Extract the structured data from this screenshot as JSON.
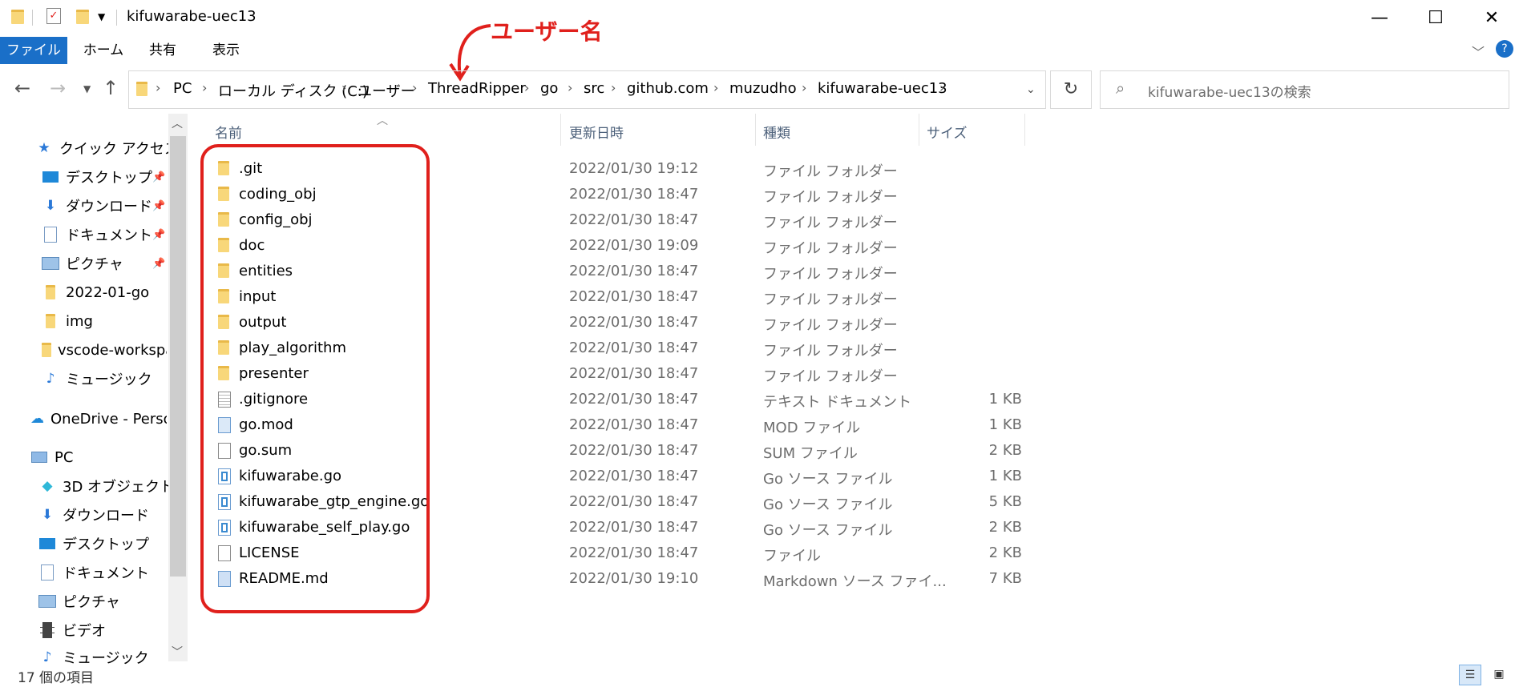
{
  "window": {
    "title": "kifuwarabe-uec13",
    "minimize": "—",
    "maximize": "☐",
    "close": "✕"
  },
  "ribbon": {
    "tabs": [
      "ファイル",
      "ホーム",
      "共有",
      "表示"
    ]
  },
  "address": {
    "breadcrumbs": [
      "PC",
      "ローカル ディスク (C:)",
      "ユーザー",
      "ThreadRipper",
      "go",
      "src",
      "github.com",
      "muzudho",
      "kifuwarabe-uec13"
    ]
  },
  "search": {
    "placeholder": "kifuwarabe-uec13の検索"
  },
  "annotation": {
    "text": "ユーザー名",
    "color": "#e0201c"
  },
  "sidebar": {
    "items": [
      {
        "label": "クイック アクセス",
        "icon": "star-icon"
      },
      {
        "label": "デスクトップ",
        "icon": "desktop-icon",
        "pinned": true
      },
      {
        "label": "ダウンロード",
        "icon": "download-icon",
        "pinned": true
      },
      {
        "label": "ドキュメント",
        "icon": "document-icon",
        "pinned": true
      },
      {
        "label": "ピクチャ",
        "icon": "picture-icon",
        "pinned": true
      },
      {
        "label": "2022-01-go",
        "icon": "folder-icon"
      },
      {
        "label": "img",
        "icon": "folder-icon"
      },
      {
        "label": "vscode-workspa",
        "icon": "folder-icon"
      },
      {
        "label": "ミュージック",
        "icon": "music-icon"
      },
      {
        "label": "OneDrive - Person",
        "icon": "cloud-icon"
      },
      {
        "label": "PC",
        "icon": "pc-icon"
      },
      {
        "label": "3D オブジェクト",
        "icon": "cube-icon"
      },
      {
        "label": "ダウンロード",
        "icon": "download-icon"
      },
      {
        "label": "デスクトップ",
        "icon": "desktop-icon"
      },
      {
        "label": "ドキュメント",
        "icon": "document-icon"
      },
      {
        "label": "ピクチャ",
        "icon": "picture-icon"
      },
      {
        "label": "ビデオ",
        "icon": "video-icon"
      },
      {
        "label": "ミュージック",
        "icon": "music-icon"
      }
    ]
  },
  "columns": {
    "name": "名前",
    "date": "更新日時",
    "type": "種類",
    "size": "サイズ"
  },
  "files": [
    {
      "name": ".git",
      "date": "2022/01/30 19:12",
      "type": "ファイル フォルダー",
      "size": "",
      "icon": "folder-icon"
    },
    {
      "name": "coding_obj",
      "date": "2022/01/30 18:47",
      "type": "ファイル フォルダー",
      "size": "",
      "icon": "folder-icon"
    },
    {
      "name": "config_obj",
      "date": "2022/01/30 18:47",
      "type": "ファイル フォルダー",
      "size": "",
      "icon": "folder-icon"
    },
    {
      "name": "doc",
      "date": "2022/01/30 19:09",
      "type": "ファイル フォルダー",
      "size": "",
      "icon": "folder-icon"
    },
    {
      "name": "entities",
      "date": "2022/01/30 18:47",
      "type": "ファイル フォルダー",
      "size": "",
      "icon": "folder-icon"
    },
    {
      "name": "input",
      "date": "2022/01/30 18:47",
      "type": "ファイル フォルダー",
      "size": "",
      "icon": "folder-icon"
    },
    {
      "name": "output",
      "date": "2022/01/30 18:47",
      "type": "ファイル フォルダー",
      "size": "",
      "icon": "folder-icon"
    },
    {
      "name": "play_algorithm",
      "date": "2022/01/30 18:47",
      "type": "ファイル フォルダー",
      "size": "",
      "icon": "folder-icon"
    },
    {
      "name": "presenter",
      "date": "2022/01/30 18:47",
      "type": "ファイル フォルダー",
      "size": "",
      "icon": "folder-icon"
    },
    {
      "name": ".gitignore",
      "date": "2022/01/30 18:47",
      "type": "テキスト ドキュメント",
      "size": "1 KB",
      "icon": "text-file-icon"
    },
    {
      "name": "go.mod",
      "date": "2022/01/30 18:47",
      "type": "MOD ファイル",
      "size": "1 KB",
      "icon": "mod-file-icon"
    },
    {
      "name": "go.sum",
      "date": "2022/01/30 18:47",
      "type": "SUM ファイル",
      "size": "2 KB",
      "icon": "file-icon"
    },
    {
      "name": "kifuwarabe.go",
      "date": "2022/01/30 18:47",
      "type": "Go ソース ファイル",
      "size": "1 KB",
      "icon": "go-file-icon"
    },
    {
      "name": "kifuwarabe_gtp_engine.go",
      "date": "2022/01/30 18:47",
      "type": "Go ソース ファイル",
      "size": "5 KB",
      "icon": "go-file-icon"
    },
    {
      "name": "kifuwarabe_self_play.go",
      "date": "2022/01/30 18:47",
      "type": "Go ソース ファイル",
      "size": "2 KB",
      "icon": "go-file-icon"
    },
    {
      "name": "LICENSE",
      "date": "2022/01/30 18:47",
      "type": "ファイル",
      "size": "2 KB",
      "icon": "file-icon"
    },
    {
      "name": "README.md",
      "date": "2022/01/30 19:10",
      "type": "Markdown ソース ファイ...",
      "size": "7 KB",
      "icon": "markdown-file-icon"
    }
  ],
  "status": {
    "item_count": "17 個の項目"
  }
}
